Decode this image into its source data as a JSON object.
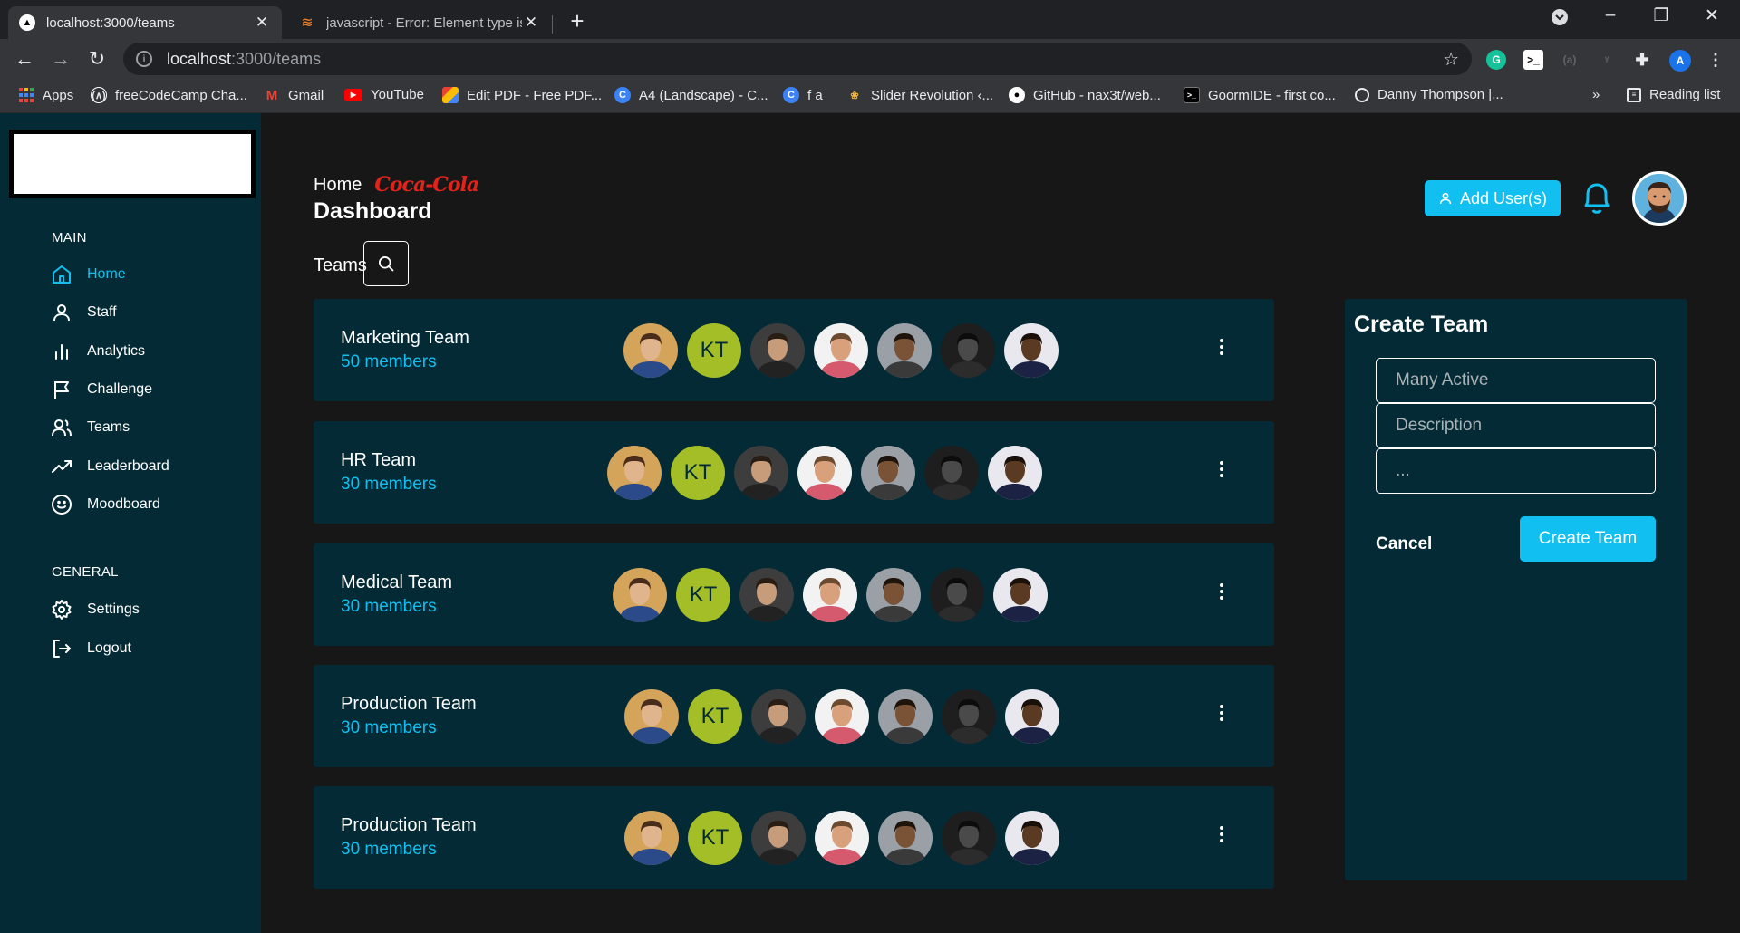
{
  "browser": {
    "tabs": [
      {
        "title": "localhost:3000/teams",
        "active": true
      },
      {
        "title": "javascript - Error: Element type is",
        "active": false
      }
    ],
    "url_host": "localhost",
    "url_path": ":3000/teams",
    "bookmarks": [
      {
        "label": "Apps",
        "icon": "apps-grid-icon"
      },
      {
        "label": "freeCodeCamp Cha...",
        "icon": "freecodecamp-icon"
      },
      {
        "label": "Gmail",
        "icon": "gmail-icon"
      },
      {
        "label": "YouTube",
        "icon": "youtube-icon"
      },
      {
        "label": "Edit PDF - Free PDF...",
        "icon": "pdf-icon"
      },
      {
        "label": "A4 (Landscape) - C...",
        "icon": "canva-icon"
      },
      {
        "label": "f a",
        "icon": "canva-icon"
      },
      {
        "label": "Slider Revolution ‹...",
        "icon": "slider-revolution-icon"
      },
      {
        "label": "GitHub - nax3t/web...",
        "icon": "github-icon"
      },
      {
        "label": "GoormIDE - first co...",
        "icon": "terminal-icon"
      },
      {
        "label": "Danny Thompson |...",
        "icon": "chrome-icon"
      }
    ],
    "more_bookmarks": "»",
    "reading_list": "Reading list",
    "profile_initial": "A"
  },
  "sidebar": {
    "main_label": "MAIN",
    "main_items": [
      {
        "label": "Home",
        "icon": "home-icon",
        "active": true
      },
      {
        "label": "Staff",
        "icon": "user-icon",
        "active": false
      },
      {
        "label": "Analytics",
        "icon": "bar-chart-icon",
        "active": false
      },
      {
        "label": "Challenge",
        "icon": "flag-icon",
        "active": false
      },
      {
        "label": "Teams",
        "icon": "users-icon",
        "active": false
      },
      {
        "label": "Leaderboard",
        "icon": "trending-up-icon",
        "active": false
      },
      {
        "label": "Moodboard",
        "icon": "smile-icon",
        "active": false
      }
    ],
    "general_label": "GENERAL",
    "general_items": [
      {
        "label": "Settings",
        "icon": "gear-icon"
      },
      {
        "label": "Logout",
        "icon": "logout-icon"
      }
    ]
  },
  "header": {
    "breadcrumb": "Home",
    "brand": "Coca-Cola",
    "title": "Dashboard",
    "section": "Teams",
    "add_user_label": "Add User(s)"
  },
  "teams": [
    {
      "name": "Marketing Team",
      "members": "50 members"
    },
    {
      "name": "HR Team",
      "members": "30 members"
    },
    {
      "name": "Medical Team",
      "members": "30 members"
    },
    {
      "name": "Production Team",
      "members": "30 members"
    },
    {
      "name": "Production Team",
      "members": "30 members"
    }
  ],
  "avatar_initials": "KT",
  "create_team": {
    "title": "Create Team",
    "name_placeholder": "Many Active",
    "description_placeholder": "Description",
    "extra_placeholder": "...",
    "cancel_label": "Cancel",
    "submit_label": "Create Team"
  },
  "colors": {
    "accent": "#11c0f0",
    "sidebar_bg": "#032a35",
    "card_bg": "#032a35",
    "page_bg": "#171717",
    "kt_avatar": "#a3be27"
  }
}
